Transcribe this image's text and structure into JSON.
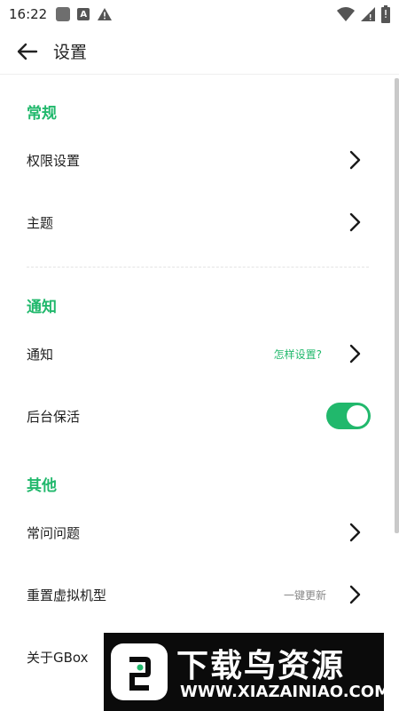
{
  "status_bar": {
    "time": "16:22",
    "left_icons": [
      "notification-square-icon",
      "app-a-icon",
      "warning-icon"
    ],
    "right_icons": [
      "wifi-icon",
      "signal-icon",
      "battery-icon"
    ],
    "app_icon_letter": "A"
  },
  "app_bar": {
    "back_icon": "arrow-left-icon",
    "title": "设置"
  },
  "sections": {
    "general": {
      "title": "常规",
      "permissions_label": "权限设置",
      "theme_label": "主题"
    },
    "notification": {
      "title": "通知",
      "notification_label": "通知",
      "notification_hint": "怎样设置?",
      "keep_alive_label": "后台保活",
      "keep_alive_on": true
    },
    "other": {
      "title": "其他",
      "faq_label": "常问问题",
      "reset_model_label": "重置虚拟机型",
      "reset_model_hint": "一键更新",
      "about_label": "关于GBox"
    }
  },
  "colors": {
    "accent": "#21b86c",
    "text": "#1f1f1f",
    "hint_gray": "#888888"
  },
  "watermark": {
    "title": "下载鸟资源",
    "url": "WWW.XIAZAINIAO.COM",
    "logo_icon": "bird-logo-icon"
  }
}
